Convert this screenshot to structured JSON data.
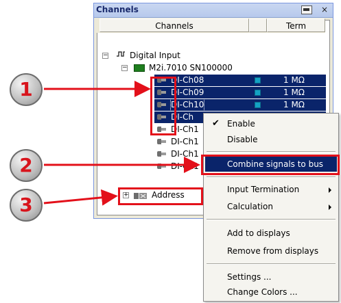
{
  "window": {
    "title": "Channels",
    "close_glyph": "×"
  },
  "columns": {
    "channels": "Channels",
    "blank": "",
    "term": "Term"
  },
  "tree": {
    "root": {
      "label": "Digital Input",
      "toggle": "−"
    },
    "device": {
      "label": "M2i.7010 SN100000",
      "toggle": "−"
    },
    "channels": [
      {
        "label": "DI-Ch08",
        "term": "1 MΩ",
        "selected": true
      },
      {
        "label": "DI-Ch09",
        "term": "1 MΩ",
        "selected": true
      },
      {
        "label": "DI-Ch10",
        "term": "1 MΩ",
        "selected": true
      },
      {
        "label": "DI-Ch",
        "term": "",
        "selected": true
      },
      {
        "label": "DI-Ch1",
        "term": "",
        "selected": false
      },
      {
        "label": "DI-Ch1",
        "term": "",
        "selected": false
      },
      {
        "label": "DI-Ch1",
        "term": "",
        "selected": false
      },
      {
        "label": "DI-Ch1",
        "term": "",
        "selected": false
      }
    ],
    "address": {
      "label": "Address",
      "toggle": "+"
    }
  },
  "context_menu": {
    "check_glyph": "✔",
    "items": [
      {
        "label": "Enable",
        "checked": true
      },
      {
        "label": "Disable"
      },
      {
        "label": "Combine signals to bus",
        "highlighted": true
      },
      {
        "label": "Input Termination",
        "submenu": true
      },
      {
        "label": "Calculation",
        "submenu": true
      },
      {
        "label": "Add to displays"
      },
      {
        "label": "Remove from displays"
      },
      {
        "label": "Settings ..."
      },
      {
        "label": "Change Colors ..."
      }
    ]
  },
  "callouts": [
    "1",
    "2",
    "3"
  ],
  "colors": {
    "selection": "#0a246a",
    "annotation_red": "#e3101a",
    "chip_cyan": "#14a2c4"
  }
}
